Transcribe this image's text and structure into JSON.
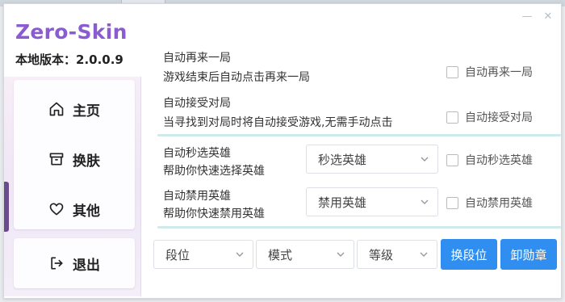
{
  "app": {
    "brand": "Zero-Skin",
    "version_label": "本地版本：2.0.0.9"
  },
  "window_controls": {
    "minimize_glyph": "—",
    "close_glyph": "✕"
  },
  "sidebar": {
    "items": [
      {
        "label": "主页",
        "icon": "home-icon"
      },
      {
        "label": "换肤",
        "icon": "archive-icon"
      },
      {
        "label": "其他",
        "icon": "heart-icon"
      },
      {
        "label": "退出",
        "icon": "logout-icon"
      }
    ]
  },
  "options": [
    {
      "title": "自动再来一局",
      "desc": "游戏结束后自动点击再来一局",
      "checkbox": "自动再来一局",
      "checked": false
    },
    {
      "title": "自动接受对局",
      "desc": "当寻找到对局时将自动接受游戏,无需手动点击",
      "checkbox": "自动接受对局",
      "checked": false
    },
    {
      "title": "自动秒选英雄",
      "desc": "帮助你快速选择英雄",
      "select": "秒选英雄",
      "checkbox": "自动秒选英雄",
      "checked": false
    },
    {
      "title": "自动禁用英雄",
      "desc": "帮助你快速禁用英雄",
      "select": "禁用英雄",
      "checkbox": "自动禁用英雄",
      "checked": false
    }
  ],
  "bottom_bar": {
    "selects": [
      "段位",
      "模式",
      "等级"
    ],
    "buttons": [
      "换段位",
      "卸勋章"
    ]
  },
  "colors": {
    "brand": "#8a5cd0",
    "primary_button": "#2f8ef0",
    "divider": "#cfeaea"
  }
}
